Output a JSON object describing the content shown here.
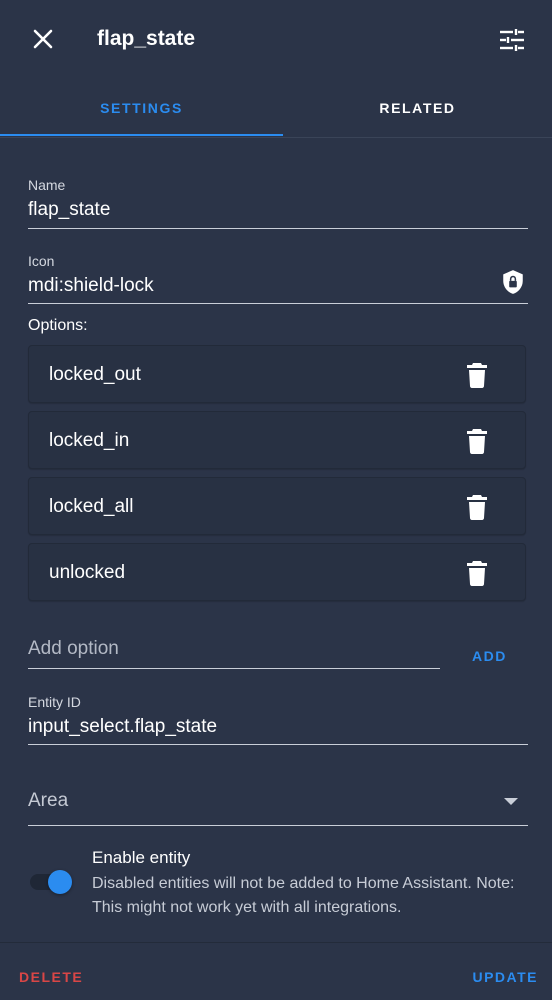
{
  "header": {
    "title": "flap_state"
  },
  "tabs": [
    {
      "label": "SETTINGS",
      "active": true
    },
    {
      "label": "RELATED",
      "active": false
    }
  ],
  "name_field": {
    "label": "Name",
    "value": "flap_state"
  },
  "icon_field": {
    "label": "Icon",
    "value": "mdi:shield-lock",
    "preview_icon": "shield-lock-icon"
  },
  "options": {
    "label": "Options:",
    "items": [
      {
        "label": "locked_out"
      },
      {
        "label": "locked_in"
      },
      {
        "label": "locked_all"
      },
      {
        "label": "unlocked"
      }
    ]
  },
  "add_option": {
    "placeholder": "Add option",
    "button_label": "ADD"
  },
  "entity_id_field": {
    "label": "Entity ID",
    "value": "input_select.flap_state"
  },
  "area_field": {
    "label": "Area"
  },
  "enable_entity": {
    "title": "Enable entity",
    "description": "Disabled entities will not be added to Home Assistant. Note: This might not work yet with all integrations.",
    "enabled": true
  },
  "footer": {
    "delete_label": "DELETE",
    "update_label": "UPDATE"
  },
  "colors": {
    "background": "#2b3448",
    "accent": "#2b8cf0",
    "danger": "#d94646"
  }
}
